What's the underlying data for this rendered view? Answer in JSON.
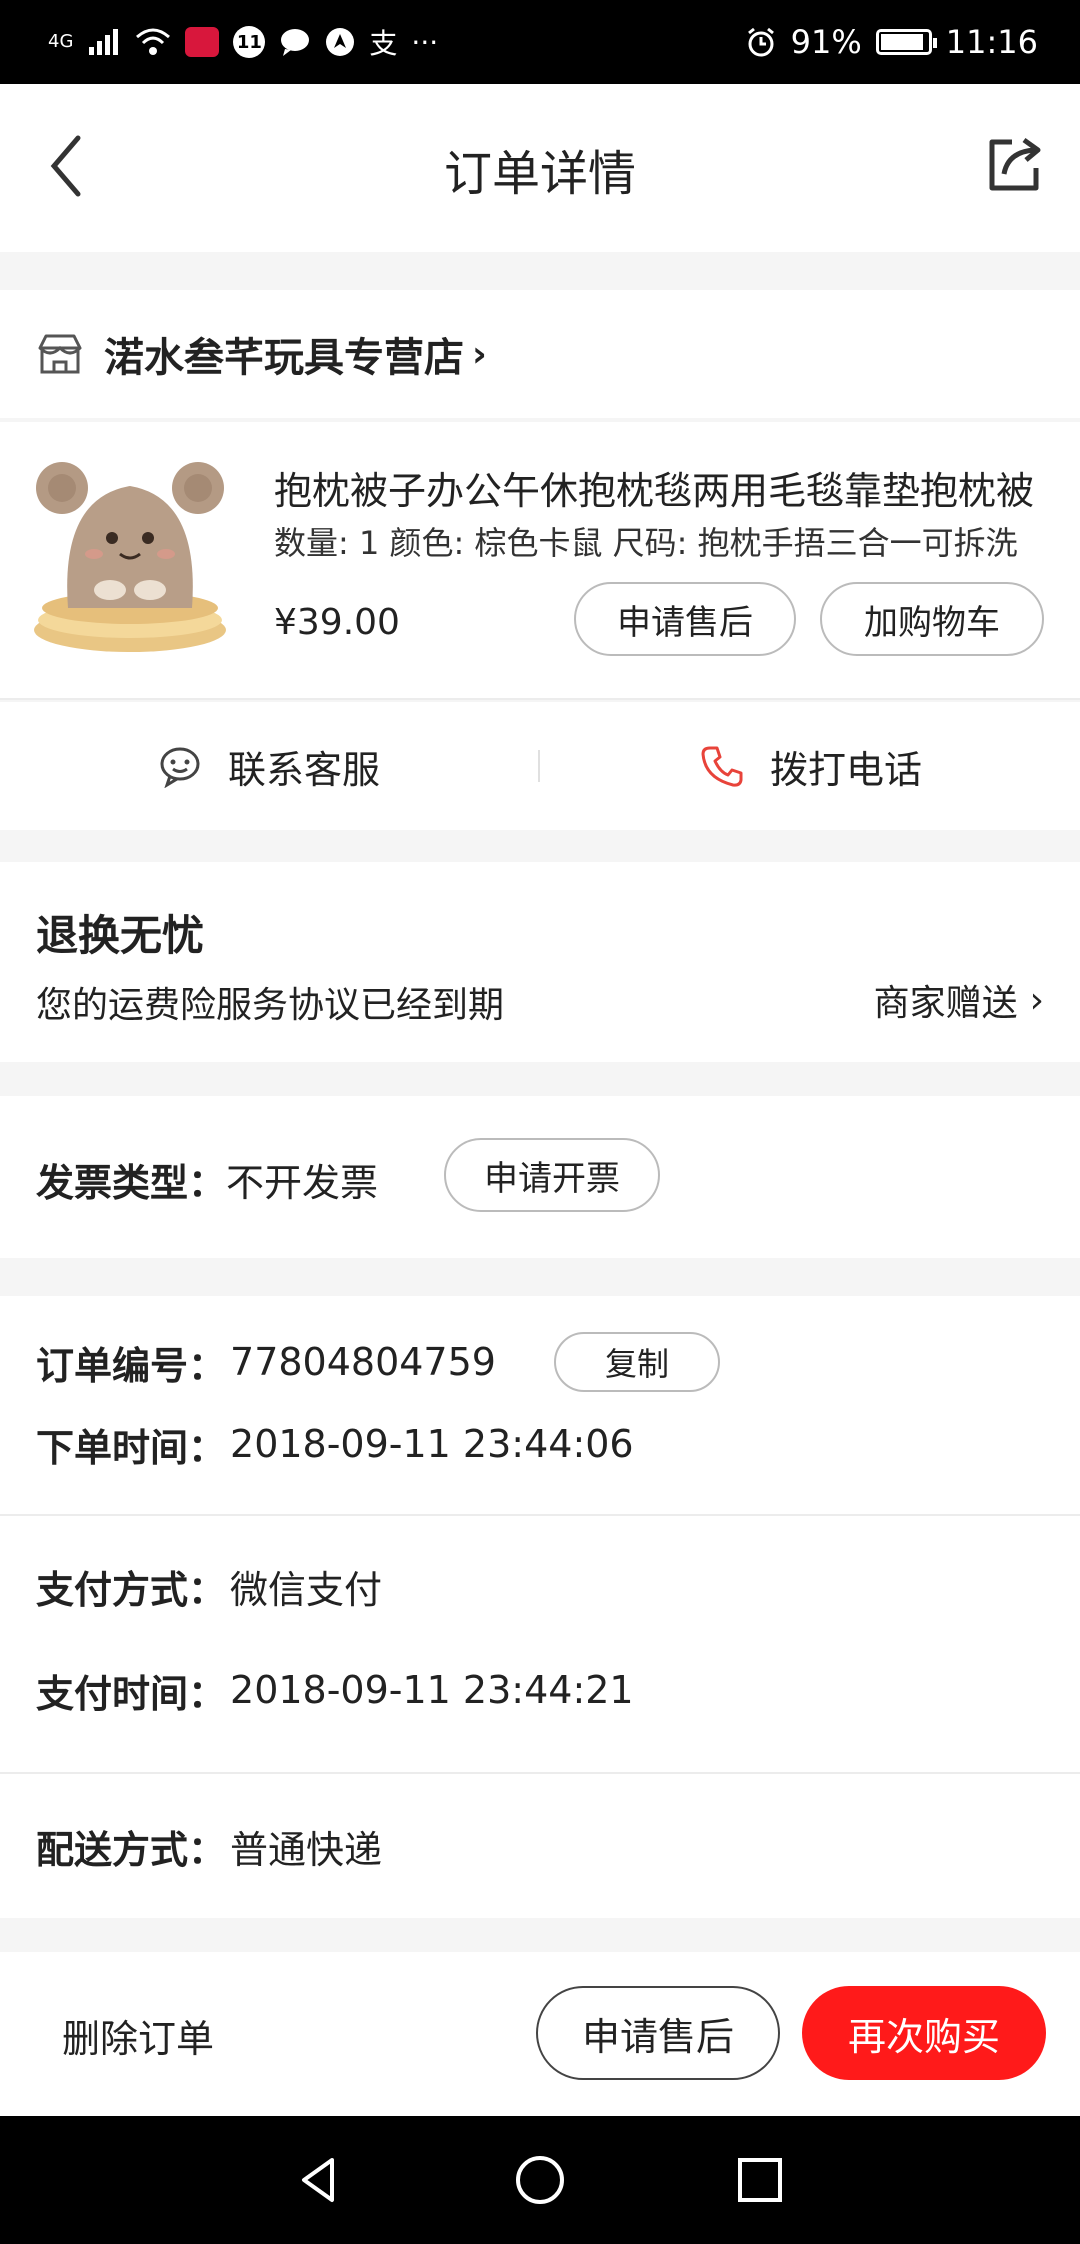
{
  "status_bar": {
    "network": "4G",
    "battery_percent": "91%",
    "battery_level": 0.91,
    "time": "11:16",
    "notification_glyph": "支",
    "more": "···"
  },
  "header": {
    "title": "订单详情",
    "back_icon": "chevron-left-icon",
    "share_icon": "share-icon"
  },
  "store": {
    "name": "渃水叁芊玩具专营店",
    "chevron": "›"
  },
  "product": {
    "title": "抱枕被子办公午休抱枕毯两用毛毯靠垫抱枕被",
    "spec": "数量: 1 颜色: 棕色卡鼠 尺码: 抱枕手捂三合一可拆洗",
    "price": "¥39.00",
    "aftersale_button": "申请售后",
    "cart_button": "加购物车"
  },
  "contact": {
    "service_label": "联系客服",
    "phone_label": "拨打电话",
    "phone_color": "#e8433a"
  },
  "returns": {
    "title": "退换无忧",
    "description": "您的运费险服务协议已经到期",
    "gift_label": "商家赠送",
    "chevron": "›"
  },
  "invoice": {
    "label": "发票类型：",
    "value": "不开发票",
    "button": "申请开票"
  },
  "order": {
    "number_label": "订单编号：",
    "number_value": "77804804759",
    "copy_button": "复制",
    "time_label": "下单时间：",
    "time_value": "2018-09-11 23:44:06"
  },
  "payment": {
    "method_label": "支付方式：",
    "method_value": "微信支付",
    "time_label": "支付时间：",
    "time_value": "2018-09-11 23:44:21"
  },
  "shipping": {
    "label": "配送方式：",
    "value": "普通快递"
  },
  "bottom_bar": {
    "delete_label": "删除订单",
    "aftersale_label": "申请售后",
    "rebuy_label": "再次购买",
    "accent": "#ff1a1a"
  }
}
